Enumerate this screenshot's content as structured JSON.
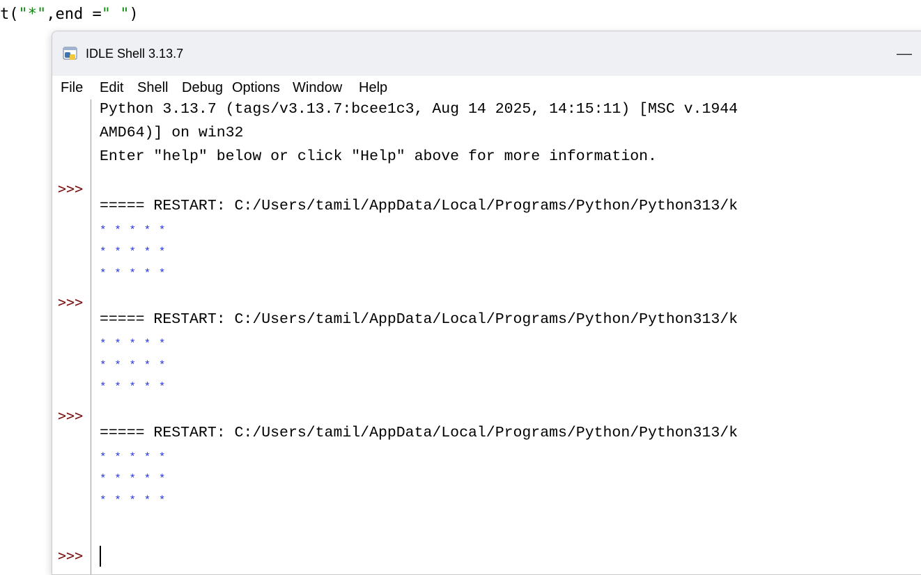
{
  "background_editor": {
    "partial_line": "",
    "line": {
      "prefix": "t(",
      "str1": "\"*\"",
      "middle": ",end =",
      "str2": "\" \"",
      "suffix": ")"
    }
  },
  "window": {
    "title": "IDLE Shell 3.13.7",
    "minimize_label": "—",
    "icon": "python-idle-icon"
  },
  "menu": {
    "items": [
      "File",
      "Edit",
      "Shell",
      "Debug",
      "Options",
      "Window",
      "Help"
    ]
  },
  "shell": {
    "prompt": ">>>",
    "banner": [
      "Python 3.13.7 (tags/v3.13.7:bcee1c3, Aug 14 2025, 14:15:11) [MSC v.1944",
      "AMD64)] on win32",
      "Enter \"help\" below or click \"Help\" above for more information."
    ],
    "runs": [
      {
        "restart": "===== RESTART: C:/Users/tamil/AppData/Local/Programs/Python/Python313/k",
        "output": [
          "* * * * *",
          "* * * * *",
          "* * * * *"
        ]
      },
      {
        "restart": "===== RESTART: C:/Users/tamil/AppData/Local/Programs/Python/Python313/k",
        "output": [
          "* * * * *",
          "* * * * *",
          "* * * * *"
        ]
      },
      {
        "restart": "===== RESTART: C:/Users/tamil/AppData/Local/Programs/Python/Python313/k",
        "output": [
          "* * * * *",
          "* * * * *",
          "* * * * *"
        ]
      }
    ]
  },
  "colors": {
    "prompt": "#7a0f0f",
    "star_output": "#2233dd",
    "string_literal": "#118811",
    "titlebar_bg": "#eef0f4"
  }
}
